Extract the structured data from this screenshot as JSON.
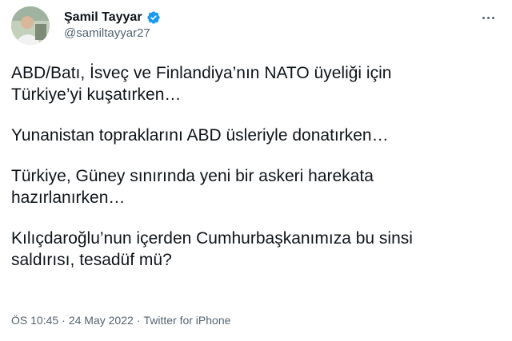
{
  "user": {
    "display_name": "Şamil Tayyar",
    "handle": "@samiltayyar27",
    "verified_color": "#1d9bf0"
  },
  "tweet": {
    "paragraphs": [
      "ABD/Batı, İsveç ve Finlandiya’nın NATO üyeliği için\nTürkiye’yi kuşatırken…",
      "Yunanistan topraklarını ABD üsleriyle donatırken…",
      "Türkiye, Güney sınırında yeni bir askeri harekata\nhazırlanırken…",
      "Kılıçdaroğlu’nun içerden Cumhurbaşkanımıza bu sinsi\nsaldırısı, tesadüf mü?"
    ]
  },
  "meta": {
    "time": "ÖS 10:45",
    "separator": "·",
    "date": "24 May 2022",
    "source": "Twitter for iPhone"
  },
  "icons": {
    "verified": "verified-badge-icon",
    "more": "more-options-icon"
  }
}
